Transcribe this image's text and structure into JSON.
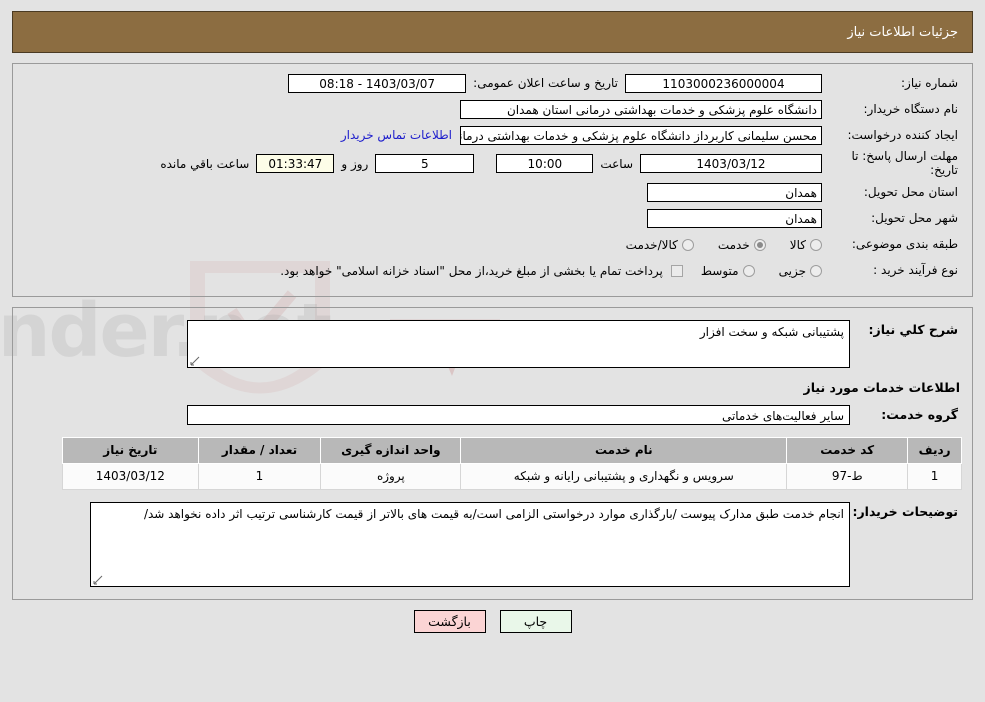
{
  "header": {
    "title": "جزئیات اطلاعات نیاز"
  },
  "form": {
    "need_number_label": "شماره نیاز:",
    "need_number_value": "1103000236000004",
    "public_announce_label": "تاریخ و ساعت اعلان عمومی:",
    "public_announce_value": "1403/03/07 - 08:18",
    "buyer_org_label": "نام دستگاه خریدار:",
    "buyer_org_value": "دانشگاه علوم پزشکی و خدمات بهداشتی درمانی استان همدان",
    "creator_label": "ایجاد کننده درخواست:",
    "creator_value": "محسن سلیمانی کاربرداز دانشگاه علوم پزشکی و خدمات بهداشتی درمانی است",
    "contact_link": "اطلاعات تماس خریدار",
    "deadline_label": "مهلت ارسال پاسخ: تا تاریخ:",
    "deadline_date": "1403/03/12",
    "hour_label": "ساعت",
    "hour_value": "10:00",
    "days_value": "5",
    "days_label": "روز و",
    "timer_value": "01:33:47",
    "remaining_label": "ساعت باقي مانده",
    "province_label": "استان محل تحویل:",
    "province_value": "همدان",
    "city_label": "شهر محل تحویل:",
    "city_value": "همدان",
    "category_label": "طبقه بندی موضوعی:",
    "category_options": [
      {
        "label": "کالا",
        "checked": false
      },
      {
        "label": "خدمت",
        "checked": true
      },
      {
        "label": "کالا/خدمت",
        "checked": false
      }
    ],
    "process_label": "نوع فرآیند خرید :",
    "process_options": [
      {
        "label": "جزیی",
        "checked": false
      },
      {
        "label": "متوسط",
        "checked": false
      }
    ],
    "treasury_note": "پرداخت تمام یا بخشی از مبلغ خرید،از محل \"اسناد خزانه اسلامی\" خواهد بود."
  },
  "details": {
    "need_desc_label": "شرح کلي نیاز:",
    "need_desc_value": "پشتیبانی شبکه و سخت افزار",
    "services_section_title": "اطلاعات خدمات مورد نیاز",
    "service_group_label": "گروه خدمت:",
    "service_group_value": "سایر فعالیت‌های خدماتی",
    "buyer_notes_label": "توضیحات خریدار:",
    "buyer_notes_value": "انجام خدمت طبق مدارک پیوست /بارگذاری موارد درخواستی الزامی است/به قیمت های بالاتر از قیمت کارشناسی ترتیب اثر داده نخواهد شد/"
  },
  "table": {
    "columns": [
      "ردیف",
      "کد خدمت",
      "نام خدمت",
      "واحد اندازه گیری",
      "تعداد / مقدار",
      "تاریخ نیاز"
    ],
    "rows": [
      {
        "index": "1",
        "code": "ط-97",
        "name": "سرویس و نگهداری و پشتیبانی رایانه و شبکه",
        "unit": "پروژه",
        "qty": "1",
        "date": "1403/03/12"
      }
    ]
  },
  "footer": {
    "print_label": "چاپ",
    "back_label": "بازگشت"
  },
  "watermark": {
    "text": "AnaTender.net"
  },
  "colors": {
    "header_bg": "#8c6d41",
    "page_bg": "#e3e3e3",
    "link": "#1c1ccc",
    "table_header": "#b8b8b8",
    "timer_bg": "#fdfde8",
    "print_btn": "#e9f7e9",
    "back_btn": "#fbd4d4"
  }
}
